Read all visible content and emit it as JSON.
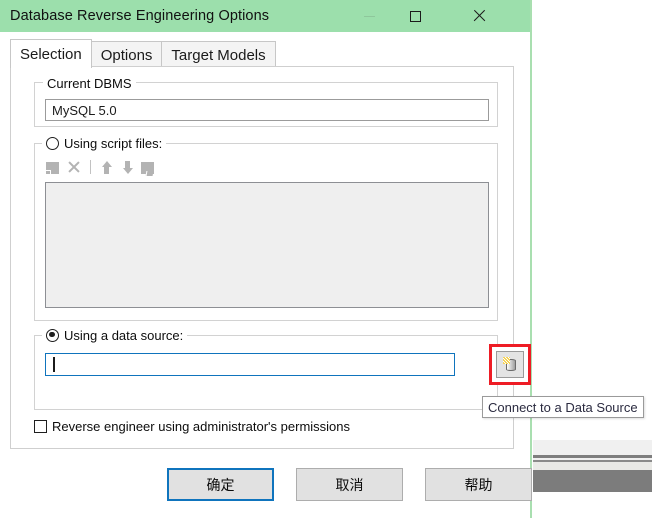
{
  "window": {
    "title": "Database Reverse Engineering Options",
    "controls": {
      "minimize": "minimize-icon",
      "maximize": "maximize-icon",
      "close": "close-icon"
    }
  },
  "tabs": [
    {
      "label": "Selection",
      "active": true
    },
    {
      "label": "Options",
      "active": false
    },
    {
      "label": "Target Models",
      "active": false
    }
  ],
  "current_dbms": {
    "legend": "Current DBMS",
    "value": "MySQL 5.0"
  },
  "script_files": {
    "legend": "Using script files:",
    "radio_selected": false,
    "toolbar": [
      {
        "icon": "add-script-icon",
        "enabled": false
      },
      {
        "icon": "delete-script-icon",
        "enabled": false
      },
      {
        "icon": "move-up-icon",
        "enabled": false
      },
      {
        "icon": "move-down-icon",
        "enabled": false
      },
      {
        "icon": "edit-script-icon",
        "enabled": false
      }
    ],
    "list_items": []
  },
  "data_source": {
    "legend": "Using a data source:",
    "radio_selected": true,
    "input_value": "",
    "input_placeholder": "",
    "connect_button_icon": "database-connect-icon",
    "tooltip": "Connect to a Data Source",
    "highlight_color": "#ee1c25"
  },
  "admin_option": {
    "label": "Reverse engineer using administrator's permissions",
    "checked": false
  },
  "footer": {
    "ok_label": "确定",
    "cancel_label": "取消",
    "help_label": "帮助"
  },
  "colors": {
    "title_bar": "#9cdfac",
    "focus_blue": "#0f74bd",
    "highlight_red": "#ee1c25"
  }
}
